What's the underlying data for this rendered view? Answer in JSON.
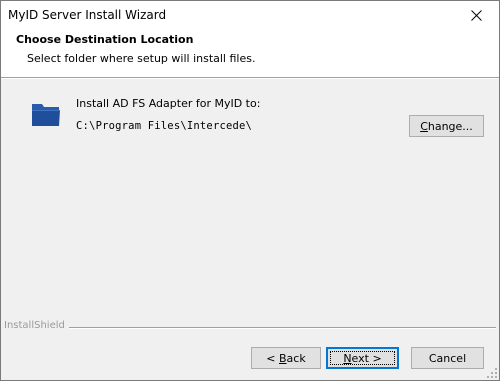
{
  "window": {
    "title": "MyID Server Install Wizard",
    "close_icon": "close-icon"
  },
  "header": {
    "title": "Choose Destination Location",
    "subtitle": "Select folder where setup will install files."
  },
  "destination": {
    "icon": "folder-icon",
    "label": "Install AD FS Adapter for MyID to:",
    "path": "C:\\Program Files\\Intercede\\",
    "change_button": {
      "pre": "",
      "accel": "C",
      "post": "hange..."
    }
  },
  "footer": {
    "brand": "InstallShield",
    "back_button": {
      "pre": "< ",
      "accel": "B",
      "post": "ack"
    },
    "next_button": {
      "pre": "",
      "accel": "N",
      "post": "ext >"
    },
    "cancel_button": "Cancel"
  },
  "colors": {
    "accent": "#0078d7",
    "folder": "#1f4e9a",
    "background": "#f0f0f0"
  }
}
